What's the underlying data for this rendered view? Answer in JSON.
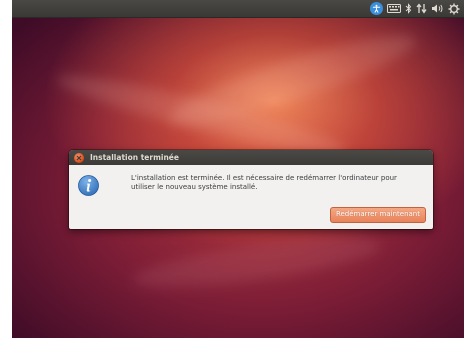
{
  "dialog": {
    "title": "Installation terminée",
    "message": "L'installation est terminée. Il est nécessaire de redémarrer l'ordinateur pour utiliser le nouveau système installé.",
    "restart_label": "Redémarrer maintenant"
  },
  "panel": {
    "indicators": [
      "accessibility-icon",
      "keyboard-icon",
      "bluetooth-icon",
      "network-icon",
      "volume-icon",
      "settings-gear-icon"
    ]
  },
  "colors": {
    "accent": "#dd4814",
    "panel": "#3c3b37",
    "accessibility": "#3b8fdc",
    "info": "#2f6fb8"
  }
}
